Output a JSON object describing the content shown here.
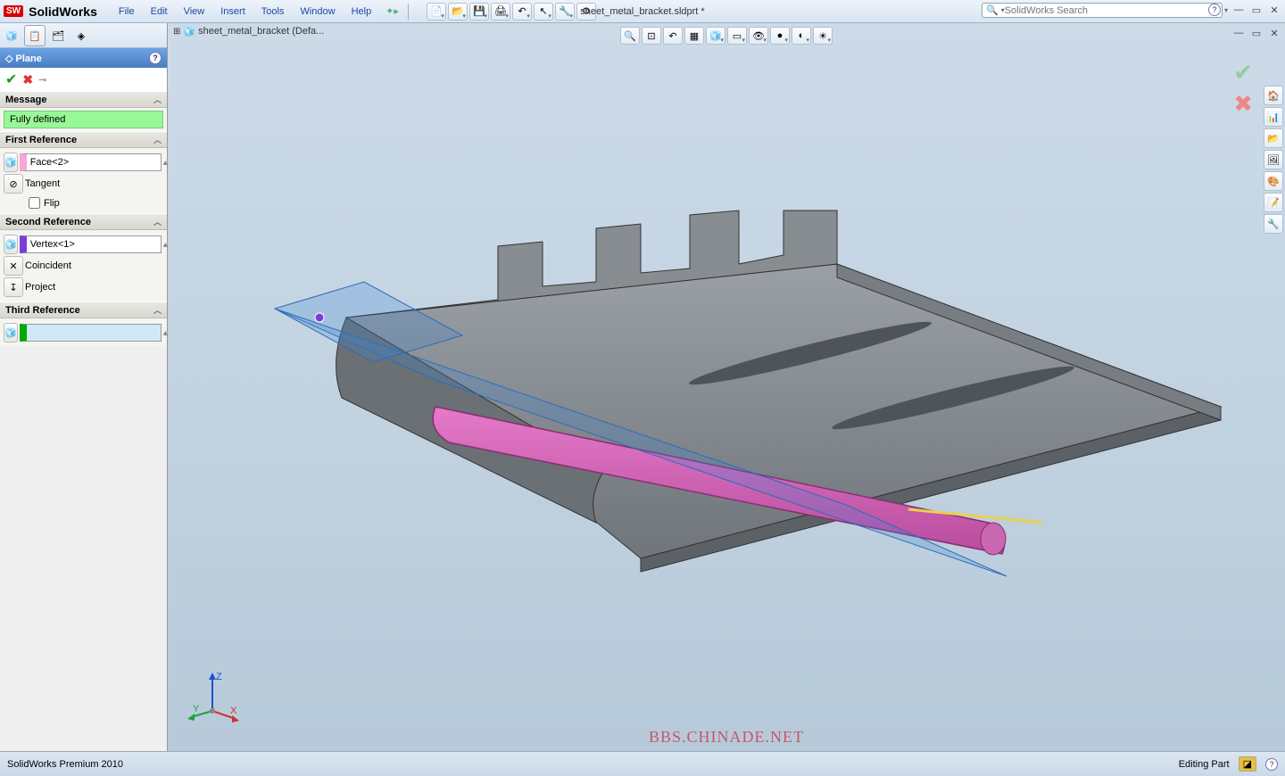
{
  "app": {
    "name": "SolidWorks",
    "document": "sheet_metal_bracket.sldprt *",
    "search_placeholder": "SolidWorks Search"
  },
  "menu": [
    "File",
    "Edit",
    "View",
    "Insert",
    "Tools",
    "Window",
    "Help"
  ],
  "tree_header": "sheet_metal_bracket (Defa...",
  "pm": {
    "title": "Plane",
    "sections": {
      "message": {
        "label": "Message",
        "status": "Fully defined"
      },
      "first": {
        "label": "First Reference",
        "value": "Face<2>",
        "opt1": "Tangent",
        "flip": "Flip"
      },
      "second": {
        "label": "Second Reference",
        "value": "Vertex<1>",
        "opt1": "Coincident",
        "opt2": "Project"
      },
      "third": {
        "label": "Third Reference",
        "value": ""
      }
    }
  },
  "triad": {
    "x": "X",
    "y": "Y",
    "z": "Z"
  },
  "status": {
    "product": "SolidWorks Premium 2010",
    "mode": "Editing Part"
  },
  "watermark": "BBS.CHINADE.NET"
}
